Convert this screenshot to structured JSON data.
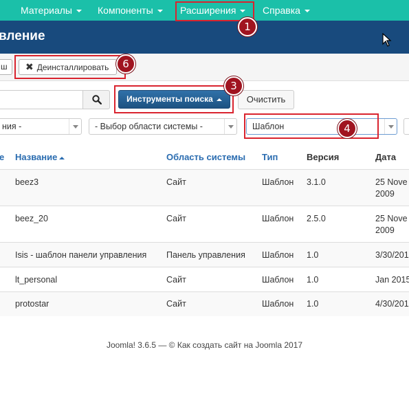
{
  "nav": {
    "items": [
      {
        "label": "Материалы"
      },
      {
        "label": "Компоненты"
      },
      {
        "label": "Расширения"
      },
      {
        "label": "Справка"
      }
    ]
  },
  "header": {
    "title": "вление"
  },
  "toolbar": {
    "partial_label": "ш",
    "uninstall_label": "Деинсталлировать"
  },
  "search": {
    "placeholder": "",
    "tools_label": "Инструменты поиска",
    "clear_label": "Очистить"
  },
  "filters": {
    "state": "ния -",
    "area": "- Выбор области системы -",
    "type": "Шаблон"
  },
  "table": {
    "headers": {
      "status": "е",
      "name": "Название",
      "area": "Область системы",
      "type": "Тип",
      "version": "Версия",
      "date": "Дата"
    },
    "rows": [
      {
        "name": "beez3",
        "area": "Сайт",
        "type": "Шаблон",
        "version": "3.1.0",
        "date": "25 Nove",
        "date2": "2009"
      },
      {
        "name": "beez_20",
        "area": "Сайт",
        "type": "Шаблон",
        "version": "2.5.0",
        "date": "25 Nove",
        "date2": "2009"
      },
      {
        "name": "Isis - шаблон панели управления",
        "area": "Панель управления",
        "type": "Шаблон",
        "version": "1.0",
        "date": "3/30/201",
        "date2": ""
      },
      {
        "name": "lt_personal",
        "area": "Сайт",
        "type": "Шаблон",
        "version": "1.0",
        "date": "Jan 2015",
        "date2": ""
      },
      {
        "name": "protostar",
        "area": "Сайт",
        "type": "Шаблон",
        "version": "1.0",
        "date": "4/30/201",
        "date2": ""
      }
    ]
  },
  "footer": {
    "text": "Joomla! 3.6.5  —  © Как создать сайт на Joomla 2017"
  },
  "annotations": [
    "1",
    "3",
    "4",
    "6"
  ],
  "colors": {
    "nav_bg": "#1bc0a9",
    "header_bg": "#184a7d",
    "primary_btn": "#2d6ca2",
    "highlight": "#d9232e",
    "badge": "#a01420"
  }
}
